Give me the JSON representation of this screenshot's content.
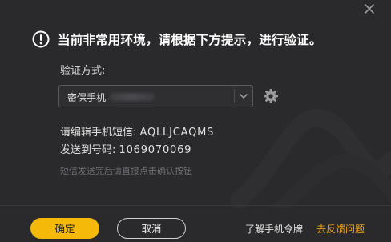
{
  "title": "当前非常用环境，请根据下方提示，进行验证。",
  "verify_method": {
    "label": "验证方式:",
    "selected": "密保手机"
  },
  "sms_edit": {
    "label": "请编辑手机短信: ",
    "value": "AQLLJCAQMS"
  },
  "send_to": {
    "label": "发送到号码: ",
    "value": "1069070069"
  },
  "hint": "短信发送完后请直接点击确认按钮",
  "buttons": {
    "confirm": "确定",
    "cancel": "取消"
  },
  "links": {
    "learn_token": "了解手机令牌",
    "feedback": "去反馈问题"
  },
  "colors": {
    "accent": "#f5b90a",
    "feedback_link": "#f0a11a",
    "background": "#2a2a2c"
  },
  "icons": [
    "close-icon",
    "warning-icon",
    "chevron-down-icon",
    "gear-icon"
  ]
}
